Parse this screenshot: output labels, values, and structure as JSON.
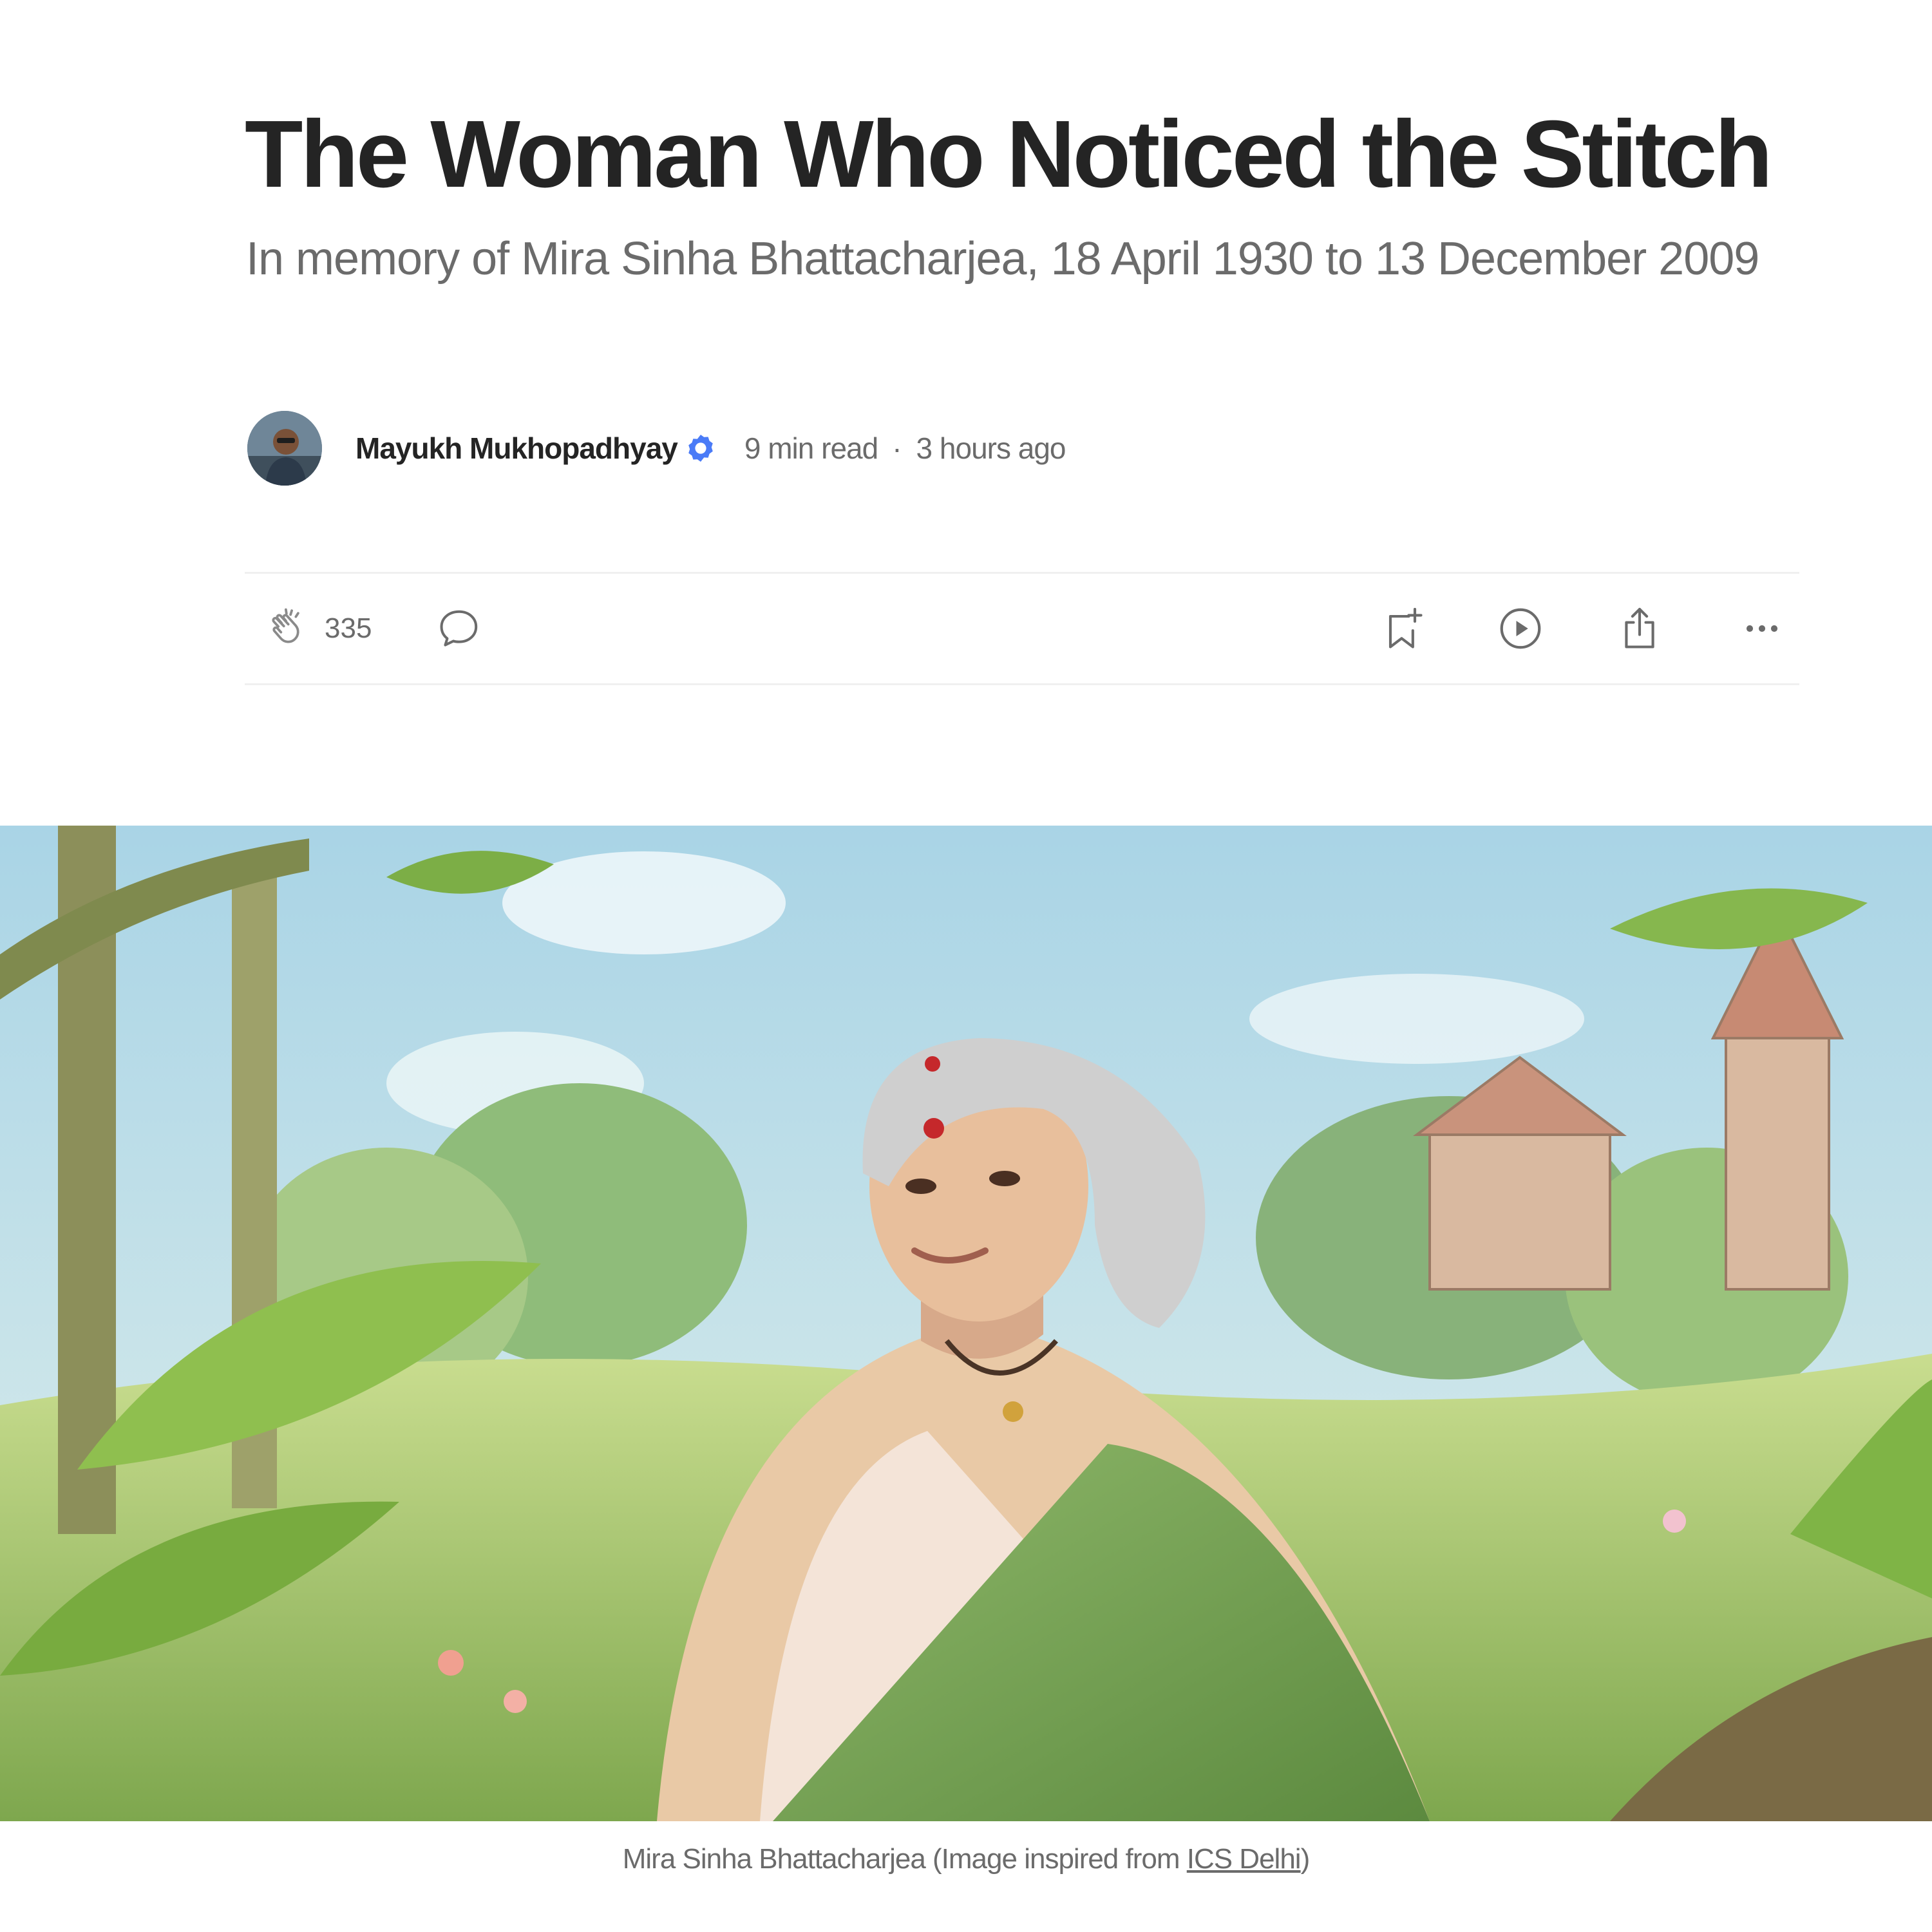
{
  "article": {
    "title": "The Woman Who Noticed the Stitch",
    "subtitle": "In memory of Mira Sinha Bhattacharjea, 18 April 1930 to 13 December 2009"
  },
  "byline": {
    "author": "Mayukh Mukhopadhyay",
    "read_time": "9 min read",
    "separator": "·",
    "posted": "3 hours ago"
  },
  "actions": {
    "clap_count": "335",
    "icons": [
      "clap-icon",
      "comment-icon",
      "bookmark-icon",
      "listen-icon",
      "share-icon",
      "more-icon"
    ]
  },
  "hero": {
    "caption_prefix": "Mira Sinha Bhattacharjea (Image inspired from ",
    "caption_link": "ICS Delhi",
    "caption_suffix": ")"
  },
  "colors": {
    "text": "#242424",
    "muted": "#6b6b6b",
    "divider": "#f0f0f0",
    "verified_badge": "#4a7bf7"
  }
}
